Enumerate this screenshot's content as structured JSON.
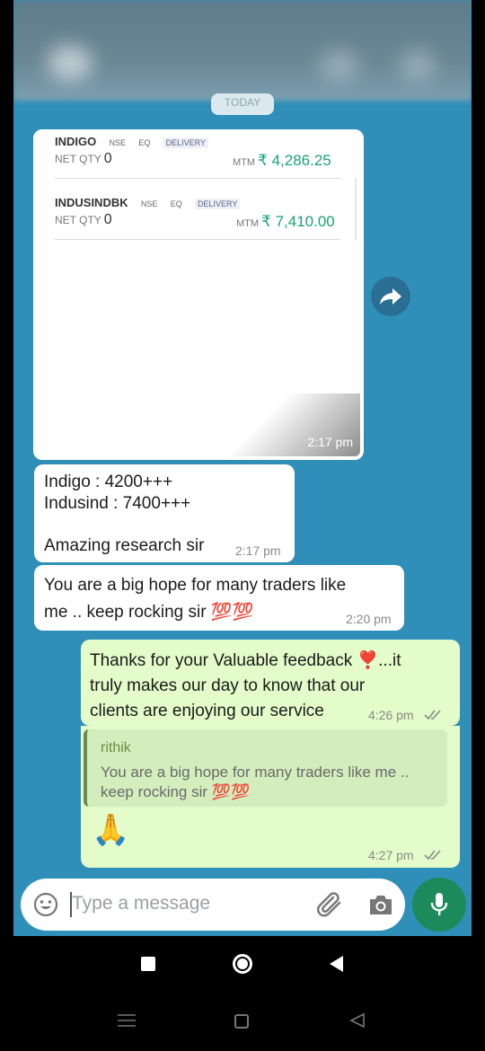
{
  "chat": {
    "date_pill": "TODAY",
    "image_message": {
      "rows": [
        {
          "name": "INDIGO",
          "exchange": "NSE",
          "segment": "EQ",
          "product": "DELIVERY",
          "netqty_label": "NET QTY",
          "netqty": "0",
          "mtm_label": "MTM",
          "mtm_value": "₹ 4,286.25"
        },
        {
          "name": "INDUSINDBK",
          "exchange": "NSE",
          "segment": "EQ",
          "product": "DELIVERY",
          "netqty_label": "NET QTY",
          "netqty": "0",
          "mtm_label": "MTM",
          "mtm_value": "₹ 7,410.00"
        }
      ],
      "time": "2:17 pm"
    },
    "messages": [
      {
        "line1": "Indigo : 4200+++",
        "line2": "Indusind : 7400+++",
        "line3": "Amazing research sir",
        "time": "2:17 pm"
      },
      {
        "line1": "You are a big hope for many traders like",
        "line2": "me .. keep rocking sir 💯💯",
        "time": "2:20 pm"
      },
      {
        "line1": "Thanks for your Valuable feedback ❣️...it",
        "line2": "truly makes our day to know that our",
        "line3": "clients are enjoying our service",
        "time": "4:26 pm"
      }
    ],
    "reply": {
      "quote_author": "rithik",
      "quote_line1": "You are a big hope for many traders like me ..",
      "quote_line2": "keep rocking sir 💯💯",
      "emoji": "🙏",
      "time": "4:27 pm"
    }
  },
  "composer": {
    "placeholder": "Type a message"
  },
  "colors": {
    "chat_bg": "#2f8fb9",
    "incoming": "#ffffff",
    "outgoing": "#e3fcc9",
    "accent": "#1c8a5a",
    "mtm_green": "#1aa372"
  }
}
